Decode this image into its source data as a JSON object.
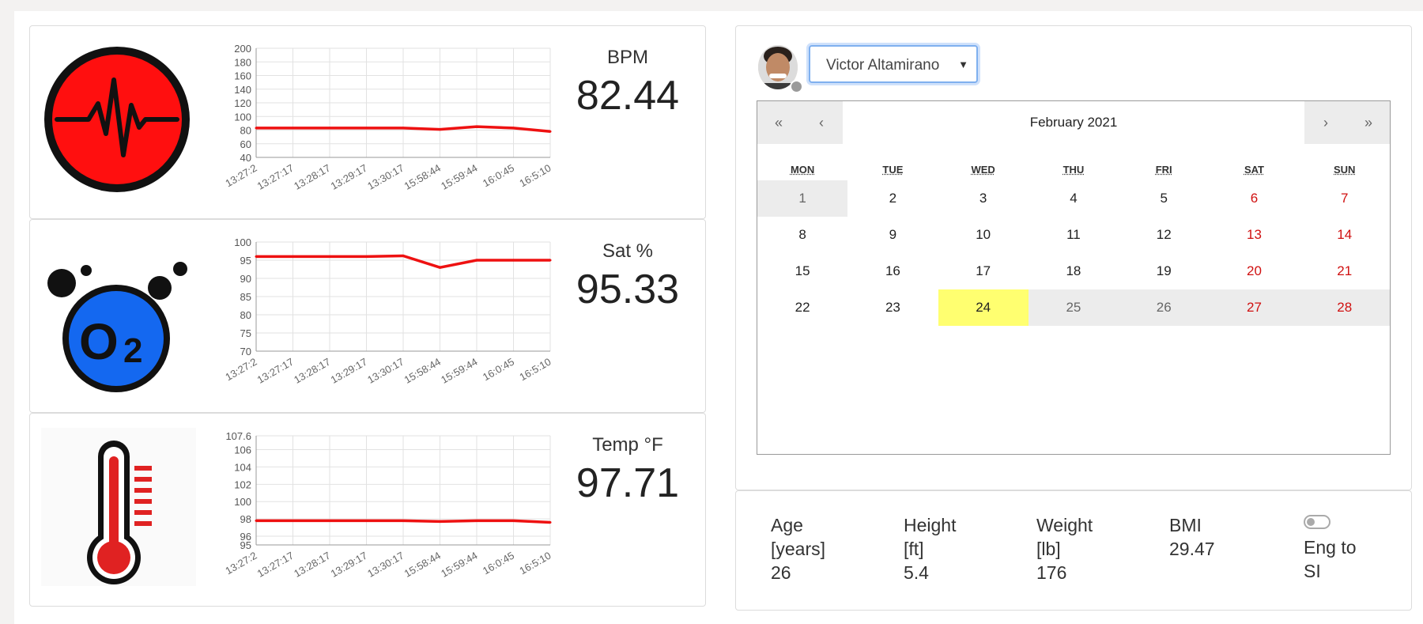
{
  "vitals": [
    {
      "key": "bpm",
      "label": "BPM",
      "value": "82.44",
      "icon": "heartbeat-icon",
      "chart_data": {
        "type": "line",
        "x": [
          "13:27:2",
          "13:27:17",
          "13:28:17",
          "13:29:17",
          "13:30:17",
          "15:58:44",
          "15:59:44",
          "16:0:45",
          "16:5:10"
        ],
        "series": [
          {
            "values": [
              83,
              83,
              83,
              83,
              83,
              81,
              85,
              83,
              78
            ]
          }
        ],
        "ylim": [
          40,
          200
        ],
        "yticks": [
          40,
          60,
          80,
          100,
          120,
          140,
          160,
          180,
          200
        ],
        "grid": true,
        "color": "#ee1111"
      }
    },
    {
      "key": "sat",
      "label": "Sat %",
      "value": "95.33",
      "icon": "oxygen-icon",
      "chart_data": {
        "type": "line",
        "x": [
          "13:27:2",
          "13:27:17",
          "13:28:17",
          "13:29:17",
          "13:30:17",
          "15:58:44",
          "15:59:44",
          "16:0:45",
          "16:5:10"
        ],
        "series": [
          {
            "values": [
              96,
              96,
              96,
              96,
              96.2,
              93,
              95,
              95,
              95
            ]
          }
        ],
        "ylim": [
          70,
          100
        ],
        "yticks": [
          70,
          75,
          80,
          85,
          90,
          95,
          100
        ],
        "grid": true,
        "color": "#ee1111"
      }
    },
    {
      "key": "temp",
      "label": "Temp °F",
      "value": "97.71",
      "icon": "thermometer-icon",
      "chart_data": {
        "type": "line",
        "x": [
          "13:27:2",
          "13:27:17",
          "13:28:17",
          "13:29:17",
          "13:30:17",
          "15:58:44",
          "15:59:44",
          "16:0:45",
          "16:5:10"
        ],
        "series": [
          {
            "values": [
              97.8,
              97.8,
              97.8,
              97.8,
              97.8,
              97.7,
              97.8,
              97.8,
              97.6
            ]
          }
        ],
        "ylim": [
          95,
          107.6
        ],
        "yticks": [
          95,
          96,
          98,
          100,
          102,
          104,
          106,
          107.6
        ],
        "grid": true,
        "color": "#ee1111"
      }
    }
  ],
  "patient": {
    "name": "Victor Altamirano"
  },
  "calendar": {
    "title": "February 2021",
    "nav": {
      "prev_year": "«",
      "prev_month": "‹",
      "next_month": "›",
      "next_year": "»"
    },
    "weekdays": [
      "MON",
      "TUE",
      "WED",
      "THU",
      "FRI",
      "SAT",
      "SUN"
    ],
    "weeks": [
      [
        "1",
        "2",
        "3",
        "4",
        "5",
        "6",
        "7"
      ],
      [
        "8",
        "9",
        "10",
        "11",
        "12",
        "13",
        "14"
      ],
      [
        "15",
        "16",
        "17",
        "18",
        "19",
        "20",
        "21"
      ],
      [
        "22",
        "23",
        "24",
        "25",
        "26",
        "27",
        "28"
      ]
    ],
    "today": "24",
    "weekend_color": "#d01010",
    "today_color": "#ffff70"
  },
  "stats": {
    "age": {
      "label_line1": "Age",
      "label_line2": "[years]",
      "value": "26"
    },
    "height": {
      "label_line1": "Height",
      "label_line2": "[ft]",
      "value": "5.4"
    },
    "weight": {
      "label_line1": "Weight",
      "label_line2": "[lb]",
      "value": "176"
    },
    "bmi": {
      "label": "BMI",
      "value": "29.47"
    },
    "toggle": {
      "label_line1": "Eng to",
      "label_line2": "SI",
      "checked": false
    }
  }
}
